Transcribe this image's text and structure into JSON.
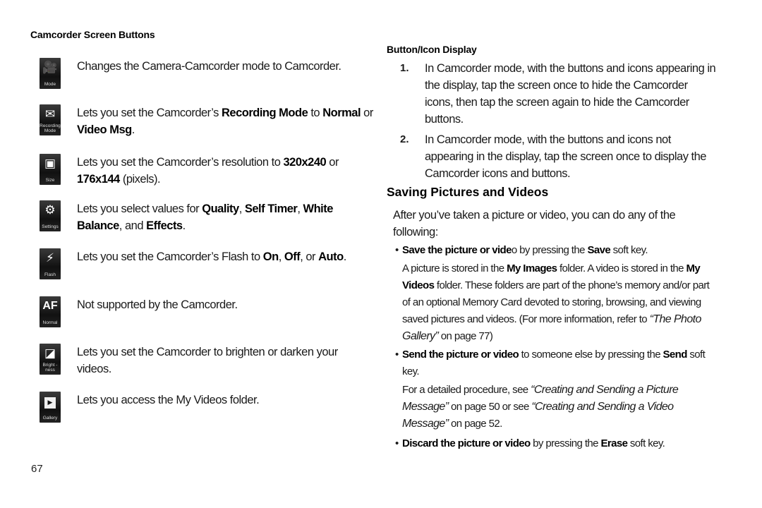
{
  "page_number": "67",
  "left": {
    "heading": "Camcorder Screen Buttons",
    "buttons": [
      {
        "icon": "camcorder-mode-icon",
        "glyph": "🎥",
        "caption": "Mode",
        "segments": [
          {
            "t": "Changes the Camera-Camcorder mode to Camcorder.",
            "b": false
          }
        ]
      },
      {
        "icon": "recording-mode-icon",
        "glyph": "✉",
        "caption": "Recording Mode",
        "segments": [
          {
            "t": "Lets you set the Camcorder’s ",
            "b": false
          },
          {
            "t": "Recording Mode",
            "b": true
          },
          {
            "t": " to ",
            "b": false
          },
          {
            "t": "Normal",
            "b": true
          },
          {
            "t": " or ",
            "b": false
          },
          {
            "t": "Video Msg",
            "b": true
          },
          {
            "t": ".",
            "b": false
          }
        ]
      },
      {
        "icon": "size-icon",
        "glyph": "▣",
        "caption": "Size",
        "segments": [
          {
            "t": "Lets you set the Camcorder’s resolution to ",
            "b": false
          },
          {
            "t": "320x240",
            "b": true
          },
          {
            "t": " or ",
            "b": false
          },
          {
            "t": "176x144",
            "b": true
          },
          {
            "t": " (pixels).",
            "b": false
          }
        ]
      },
      {
        "icon": "settings-gear-icon",
        "glyph": "⚙",
        "caption": "Settings",
        "segments": [
          {
            "t": "Lets you select values for ",
            "b": false
          },
          {
            "t": "Quality",
            "b": true
          },
          {
            "t": ", ",
            "b": false
          },
          {
            "t": "Self Timer",
            "b": true
          },
          {
            "t": ", ",
            "b": false
          },
          {
            "t": "White Balance",
            "b": true
          },
          {
            "t": ", and ",
            "b": false
          },
          {
            "t": "Effects",
            "b": true
          },
          {
            "t": ".",
            "b": false
          }
        ]
      },
      {
        "icon": "flash-icon",
        "glyph": "⚡",
        "caption": "Flash",
        "segments": [
          {
            "t": "Lets you set the Camcorder’s Flash to ",
            "b": false
          },
          {
            "t": "On",
            "b": true
          },
          {
            "t": ", ",
            "b": false
          },
          {
            "t": "Off",
            "b": true
          },
          {
            "t": ", or ",
            "b": false
          },
          {
            "t": "Auto",
            "b": true
          },
          {
            "t": ".",
            "b": false
          }
        ]
      },
      {
        "icon": "autofocus-icon",
        "glyph": "AF",
        "caption": "Normal",
        "segments": [
          {
            "t": "Not supported by the Camcorder.",
            "b": false
          }
        ]
      },
      {
        "icon": "brightness-icon",
        "glyph": "◪",
        "caption": "Bright -ness",
        "segments": [
          {
            "t": "Lets you set the Camcorder to brighten or darken your videos.",
            "b": false
          }
        ]
      },
      {
        "icon": "gallery-play-icon",
        "glyph": "▶",
        "caption": "Gallery",
        "segments": [
          {
            "t": "Lets you access the My Videos folder.",
            "b": false
          }
        ]
      }
    ]
  },
  "right": {
    "subheading": "Button/Icon Display",
    "steps": [
      {
        "num": "1.",
        "text": "In Camcorder mode, with the buttons and icons appearing in the display, tap the screen once to hide the Camcorder icons, then tap the screen again to hide the Camcorder buttons."
      },
      {
        "num": "2.",
        "text": "In Camcorder mode, with the buttons and icons not appearing in the display, tap the screen once to display the Camcorder icons and buttons."
      }
    ],
    "section_title": "Saving Pictures and Videos",
    "intro": "After you’ve taken a picture or video, you can do any of the following:",
    "bullet_char": "•",
    "bullets": [
      {
        "segments": [
          {
            "t": "Save the picture or vide",
            "s": "b"
          },
          {
            "t": "o by pressing the ",
            "s": ""
          },
          {
            "t": "Save",
            "s": "b"
          },
          {
            "t": " soft key.",
            "s": ""
          }
        ],
        "sub": [
          {
            "t": "A picture is stored in the ",
            "s": ""
          },
          {
            "t": "My Images",
            "s": "b"
          },
          {
            "t": " folder. A video is stored in the ",
            "s": ""
          },
          {
            "t": "My Videos",
            "s": "b"
          },
          {
            "t": " folder. These folders are part of the phone’s memory and/or part of an optional Memory Card devoted to storing, browsing, and viewing saved pictures and videos. (For more information, refer to ",
            "s": ""
          },
          {
            "t": "“The Photo Gallery”",
            "s": "i"
          },
          {
            "t": "  on page 77)",
            "s": ""
          }
        ]
      },
      {
        "segments": [
          {
            "t": "Send the picture or video",
            "s": "b"
          },
          {
            "t": " to someone else by pressing the ",
            "s": ""
          },
          {
            "t": "Send",
            "s": "b"
          },
          {
            "t": " soft key.",
            "s": ""
          }
        ],
        "sub": [
          {
            "t": "For a detailed procedure, see ",
            "s": ""
          },
          {
            "t": "“Creating and Sending a Picture Message”",
            "s": "i"
          },
          {
            "t": " on page 50 or see ",
            "s": ""
          },
          {
            "t": "“Creating and Sending a Video Message”",
            "s": "i"
          },
          {
            "t": " on page 52.",
            "s": ""
          }
        ]
      },
      {
        "segments": [
          {
            "t": "Discard the picture or video",
            "s": "b"
          },
          {
            "t": " by pressing the ",
            "s": ""
          },
          {
            "t": "Erase",
            "s": "b"
          },
          {
            "t": " soft key.",
            "s": ""
          }
        ],
        "sub": []
      }
    ]
  }
}
